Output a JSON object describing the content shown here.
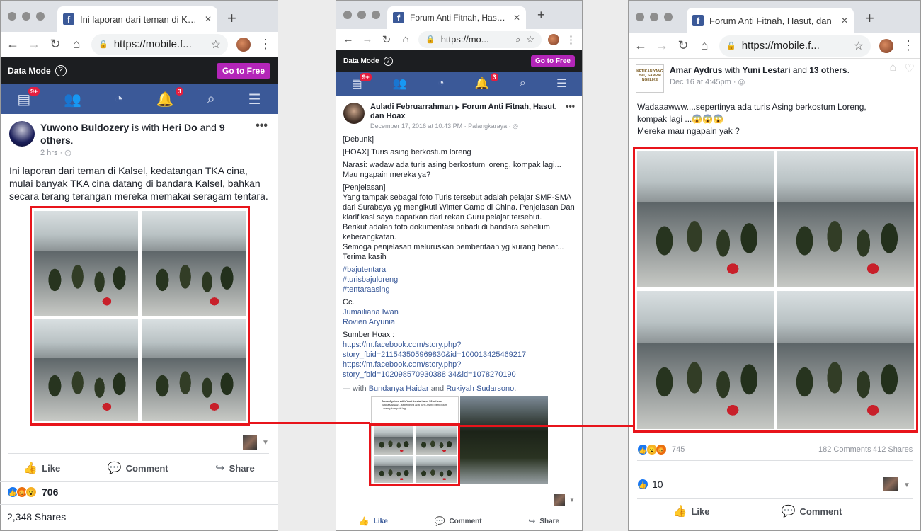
{
  "colors": {
    "facebook_blue": "#3b5998",
    "highlight_red": "#e8141b",
    "go_free_purple": "#b325b8",
    "link_blue": "#385898"
  },
  "icons": [
    "back-icon",
    "forward-icon",
    "reload-icon",
    "home-icon",
    "lock-icon",
    "star-icon",
    "kebab-icon",
    "help-icon",
    "feed-icon",
    "friends-icon",
    "messenger-icon",
    "bell-icon",
    "search-icon",
    "menu-icon",
    "like-icon",
    "comment-icon",
    "share-icon"
  ],
  "left": {
    "tab_title": "Ini laporan dari teman di Kalse",
    "url": "https://mobile.f...",
    "data_mode": "Data Mode",
    "go_free": "Go to Free",
    "badges": {
      "feed": "9+",
      "notifications": "3"
    },
    "author": "Yuwono Buldozery",
    "with_text": "is with",
    "with_name": "Heri Do",
    "and_text": "and",
    "others": "9 others",
    "period": ".",
    "time": "2 hrs · ◎",
    "text": "Ini laporan dari teman di Kalsel, kedatangan TKA cina, mulai banyak TKA cina datang di bandara Kalsel, bahkan secara terang terangan mereka memakai seragam tentara.",
    "like": "Like",
    "comment": "Comment",
    "share": "Share",
    "reaction_count": "706",
    "shares": "2,348 Shares"
  },
  "middle": {
    "tab_title": "Forum Anti Fitnah, Hasut, dan",
    "url": "https://mo...",
    "data_mode": "Data Mode",
    "go_free": "Go to Free",
    "badges": {
      "feed": "9+",
      "notifications": "3"
    },
    "author": "Auladi Februarrahman",
    "arrow": "▶",
    "group": "Forum Anti Fitnah, Hasut, dan Hoax",
    "time": "December 17, 2016 at 10:43 PM · Palangkaraya · ◎",
    "lines": [
      "[Debunk]",
      "[HOAX] Turis asing berkostum loreng",
      "Narasi: wadaw ada turis asing berkostum loreng, kompak lagi... Mau ngapain mereka ya?",
      "[Penjelasan]",
      "Yang tampak sebagai foto Turis tersebut adalah pelajar SMP-SMA dari Surabaya yg mengikuti Winter Camp di China. Penjelasan Dan klarifikasi saya dapatkan dari rekan Guru pelajar tersebut.",
      "Berikut adalah foto dokumentasi pribadi di bandara sebelum keberangkatan.",
      "Semoga penjelasan meluruskan pemberitaan yg kurang benar...",
      "Terima kasih"
    ],
    "hashtags": [
      "#bajutentara",
      "#turisbajuloreng",
      "#tentaraasing"
    ],
    "cc": "Cc.",
    "cc_names": [
      "Jumailiana Iwan",
      "Rovien Aryunia"
    ],
    "source_label": "Sumber Hoax :",
    "source_links": [
      "https://m.facebook.com/story.php?",
      "story_fbid=211543505969830&id=100013425469217",
      "https://m.facebook.com/story.php?",
      "story_fbid=102098570930388 34&id=1078270190"
    ],
    "with_prefix": "— with",
    "with_name1": "Bundanya Haidar",
    "with_and": "and",
    "with_name2": "Rukiyah Sudarsono",
    "with_suffix": ".",
    "mini_author": "Amar Aydrus with Yuni Lestari and 13 others",
    "mini_text": "Wadaaawww....sepertinya ada turis Asing berkostum Loreng kompak lagi ...",
    "like": "Like",
    "comment": "Comment",
    "share": "Share"
  },
  "right": {
    "tab_title": "Forum Anti Fitnah, Hasut, dan",
    "url": "https://mobile.f...",
    "logo_text": "KETIKAN YANG HAQ SAMPAI NGELIKE",
    "author": "Amar Aydrus",
    "with_text": "with",
    "with_name": "Yuni Lestari",
    "and_text": "and",
    "others": "13 others",
    "period": ".",
    "time": "Dec 16 at 4:45pm · ◎",
    "text_line1": "Wadaaawww....sepertinya ada turis Asing berkostum Loreng,",
    "text_line2": "kompak lagi ...😱😱😱",
    "text_line3": "Mereka mau ngapain yak ?",
    "reaction_count": "745",
    "comments": "182 Comments",
    "shares": "412 Shares",
    "likes": "10",
    "like": "Like",
    "comment": "Comment"
  }
}
